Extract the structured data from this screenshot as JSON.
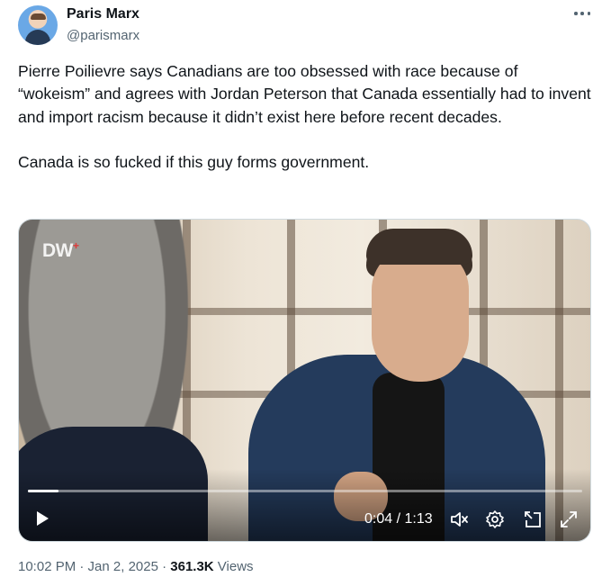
{
  "author": {
    "name": "Paris Marx",
    "handle": "@parismarx"
  },
  "tweet": {
    "text": "Pierre Poilievre says Canadians are too obsessed with race because of “wokeism” and agrees with Jordan Peterson that Canada essentially had to invent and import racism because it didn’t exist here before recent decades.\n\nCanada is so fucked if this guy forms government."
  },
  "video": {
    "watermark": "DW",
    "time_display": "0:04 / 1:13",
    "progress": 0.055
  },
  "footer": {
    "timestamp": "10:02 PM · Jan 2, 2025 · ",
    "views_count": "361.3K",
    "views_label": " Views"
  },
  "icons": {
    "more": "more-options-icon",
    "play": "play-icon",
    "mute": "volume-muted-icon",
    "settings": "settings-icon",
    "pip": "picture-in-picture-icon",
    "fullscreen": "fullscreen-icon"
  },
  "colors": {
    "text": "#0f1419",
    "secondary": "#536471",
    "video_controls": "#ffffff"
  }
}
